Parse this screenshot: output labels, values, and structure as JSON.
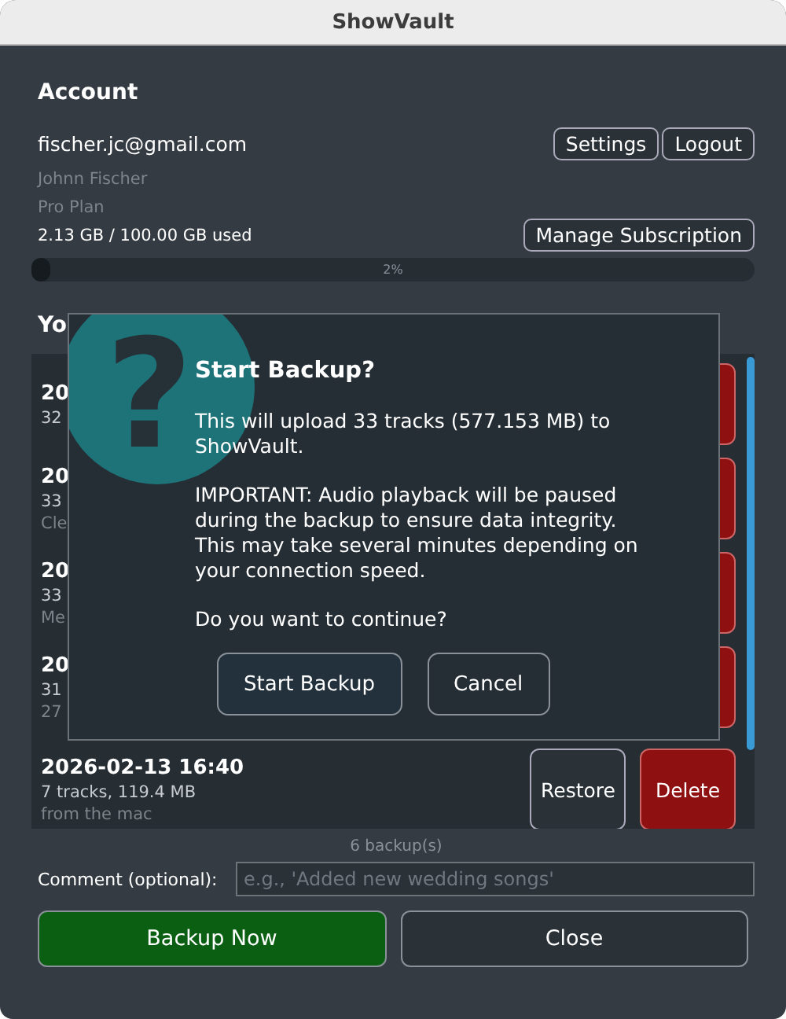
{
  "window": {
    "title": "ShowVault"
  },
  "account": {
    "heading": "Account",
    "email": "fischer.jc@gmail.com",
    "name": "Johnn Fischer",
    "plan": "Pro Plan",
    "storage": "2.13 GB / 100.00 GB used",
    "usage": {
      "level": 0.02,
      "reading": "2%"
    },
    "buttons": [
      "Settings",
      "Logout"
    ],
    "manage_button": "Manage Subscription"
  },
  "backups": {
    "heading": "Yo",
    "rows": [
      {
        "kind": "covered",
        "date": "20",
        "info": "32"
      },
      {
        "kind": "covered",
        "date": "20",
        "info": "33",
        "note": "Cle"
      },
      {
        "kind": "covered",
        "date": "20",
        "info": "33",
        "note": "Me"
      },
      {
        "kind": "covered",
        "date": "20",
        "info": "31",
        "note": "27"
      },
      {
        "kind": "full",
        "date": "2026-02-13 16:40",
        "info": "7 tracks, 119.4 MB",
        "note": "from the mac",
        "restore": "Restore",
        "delete": "Delete"
      }
    ],
    "count": "6 backup(s)"
  },
  "comment": {
    "label": "Comment (optional):",
    "placeholder": "e.g., 'Added new wedding songs'"
  },
  "buttons": {
    "primary": "Backup Now",
    "secondary": "Close"
  },
  "dialog": {
    "icon": "?",
    "title": "Start Backup?",
    "paragraphs": [
      "This will upload 33 tracks (577.153 MB) to ShowVault.",
      "IMPORTANT: Audio playback will be paused during the backup to ensure data integrity. This may take several minutes depending on your connection speed.",
      "Do you want to continue?"
    ],
    "buttons": [
      "Start Backup",
      "Cancel"
    ]
  }
}
